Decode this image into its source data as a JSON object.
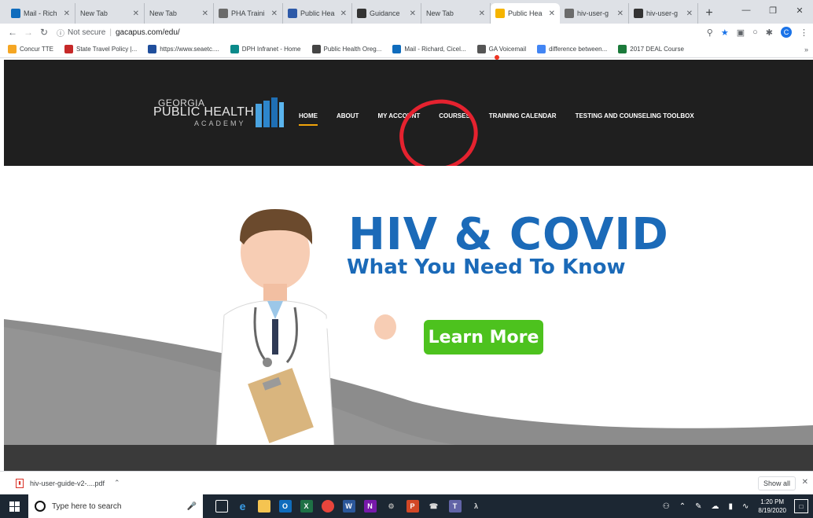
{
  "tabs": [
    {
      "label": "Mail - Rich",
      "icon": "outlook-icon",
      "color": "#0f6cbd"
    },
    {
      "label": "New Tab",
      "icon": "none",
      "color": ""
    },
    {
      "label": "New Tab",
      "icon": "none",
      "color": ""
    },
    {
      "label": "PHA Traini",
      "icon": "wordpress-icon",
      "color": "#6b6b6b"
    },
    {
      "label": "Public Hea",
      "icon": "page-icon",
      "color": "#2e5aa8"
    },
    {
      "label": "Guidance",
      "icon": "globe-icon",
      "color": "#333"
    },
    {
      "label": "New Tab",
      "icon": "none",
      "color": ""
    },
    {
      "label": "Public Hea",
      "icon": "cloud-icon",
      "color": "#f5b400"
    },
    {
      "label": "hiv-user-g",
      "icon": "wordpress-icon",
      "color": "#6b6b6b"
    },
    {
      "label": "hiv-user-g",
      "icon": "globe-icon",
      "color": "#333"
    }
  ],
  "address": {
    "security": "Not secure",
    "url": "gacapus.com/edu/"
  },
  "profile_initial": "C",
  "bookmarks": [
    {
      "label": "Concur TTE",
      "color": "#f5a623"
    },
    {
      "label": "State Travel Policy |...",
      "color": "#c62828"
    },
    {
      "label": "https://www.seaetc....",
      "color": "#1f4e9c"
    },
    {
      "label": "DPH Infranet - Home",
      "color": "#0a8a8a"
    },
    {
      "label": "Public Health Oreg...",
      "color": "#444"
    },
    {
      "label": "Mail - Richard, Cicel...",
      "color": "#0f6cbd"
    },
    {
      "label": "GA Voicemail",
      "color": "#555"
    },
    {
      "label": "difference between...",
      "color": "#4285f4"
    },
    {
      "label": "2017 DEAL Course",
      "color": "#1b7a3a"
    }
  ],
  "site": {
    "logo_line1": "GEORGIA",
    "logo_line2": "PUBLIC HEALTH",
    "logo_line3": "ACADEMY",
    "nav": [
      "HOME",
      "ABOUT",
      "MY ACCOUNT",
      "COURSES",
      "TRAINING CALENDAR",
      "TESTING AND COUNSELING TOOLBOX"
    ],
    "nav_accent": "#f0a30a"
  },
  "hero": {
    "title": "HIV & COVID",
    "subtitle": "What You Need To Know",
    "cta": "Learn More",
    "title_color": "#1b6ab8",
    "cta_color": "#4dc21e"
  },
  "downloads": {
    "file": "hiv-user-guide-v2-....pdf",
    "show_all": "Show all"
  },
  "taskbar": {
    "search_placeholder": "Type here to search",
    "time": "1:20 PM",
    "date": "8/19/2020"
  }
}
